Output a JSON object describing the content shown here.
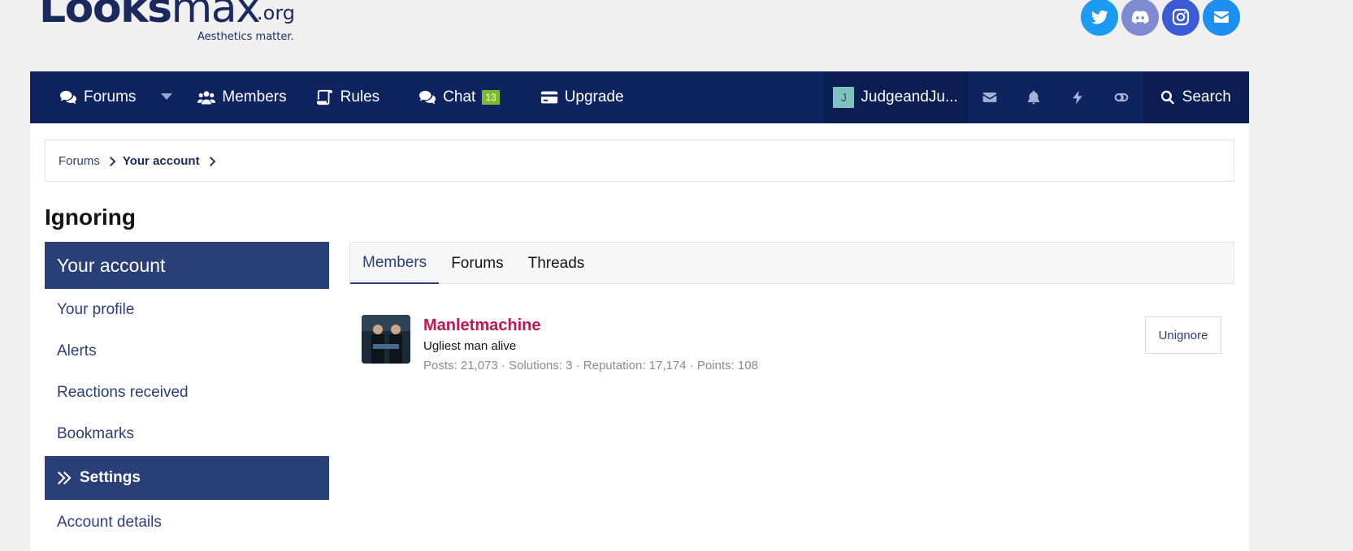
{
  "logo": {
    "main_a": "Looks",
    "main_b": "max",
    "suffix": ".org",
    "tagline": "Aesthetics matter."
  },
  "socials": [
    {
      "icon": "twitter-icon",
      "color": "#1d9bf0"
    },
    {
      "icon": "discord-icon",
      "color": "#7f8bd1"
    },
    {
      "icon": "instagram-icon",
      "color": "#3a5ad6"
    },
    {
      "icon": "email-icon",
      "color": "#1d8ff0"
    }
  ],
  "nav": {
    "forums": "Forums",
    "members": "Members",
    "rules": "Rules",
    "chat": "Chat",
    "chat_badge": "13",
    "upgrade": "Upgrade",
    "username": "JudgeandJu...",
    "avatar_letter": "J",
    "search": "Search"
  },
  "breadcrumb": {
    "forums": "Forums",
    "account": "Your account"
  },
  "page_title": "Ignoring",
  "sidebar": {
    "header": "Your account",
    "items": [
      "Your profile",
      "Alerts",
      "Reactions received",
      "Bookmarks"
    ],
    "active": "Settings",
    "after": [
      "Account details"
    ]
  },
  "tabs": [
    "Members",
    "Forums",
    "Threads"
  ],
  "member": {
    "name": "Manletmachine",
    "title": "Ugliest man alive",
    "stats": "Posts: 21,073 · Solutions: 3 · Reputation: 17,174 · Points: 108",
    "button": "Unignore"
  },
  "colors": {
    "nav_bg": "#0f2360",
    "accent": "#2a3e78",
    "name_color": "#c0174f",
    "badge": "#7fba2a"
  }
}
